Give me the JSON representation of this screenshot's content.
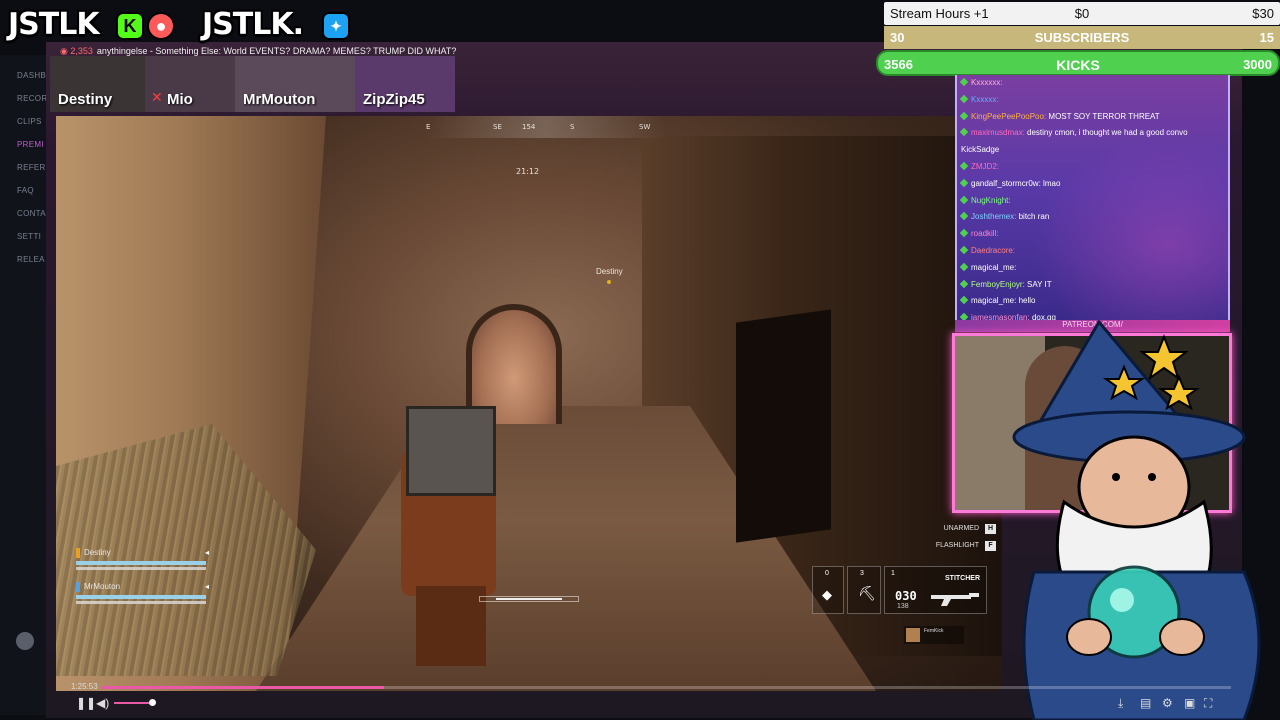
{
  "site_sidebar": {
    "items": [
      "DASHB",
      "RECOR",
      "CLIPS",
      "PREMI",
      "REFER",
      "FAQ",
      "CONTA",
      "SETTI",
      "RELEA"
    ]
  },
  "topbar": {
    "logo_1": "JSTLK",
    "logo_2": "JSTLK.",
    "ticker_count": "2,353",
    "ticker_text": "anythingelse - Something Else: World EVENTS? DRAMA? MEMES? TRUMP DID WHAT?"
  },
  "cams": [
    {
      "label": "Destiny"
    },
    {
      "label": "Mio"
    },
    {
      "label": "MrMouton"
    },
    {
      "label": "ZipZip45"
    }
  ],
  "goals": {
    "row1": {
      "left": "Stream Hours +1",
      "center": "$0",
      "right": "$30"
    },
    "row2": {
      "left": "30",
      "center": "SUBSCRIBERS",
      "right": "15"
    },
    "row3": {
      "left": "3566",
      "center": "KICKS",
      "right": "3000"
    }
  },
  "chat": {
    "messages": [
      {
        "user": "Kxxxxxx:",
        "color": "#ffb0d8",
        "text": ""
      },
      {
        "user": "Kxxxxx:",
        "color": "#5ab0ff",
        "text": ""
      },
      {
        "user": "KingPeePeePooPoo:",
        "color": "#ffb040",
        "text": "MOST SOY TERROR THREAT"
      },
      {
        "user": "maximusdmax:",
        "color": "#ff6ac0",
        "text": "destiny cmon, i thought we had a good convo"
      },
      {
        "user": "",
        "color": "#ffffff",
        "text": "KickSadge"
      },
      {
        "user": "ZMJD2:",
        "color": "#ff6ac0",
        "text": ""
      },
      {
        "user": "gandalf_stormcr0w:",
        "color": "#ffffff",
        "text": "lmao"
      },
      {
        "user": "NugKnight:",
        "color": "#7aff7a",
        "text": ""
      },
      {
        "user": "Joshthemex:",
        "color": "#80d0ff",
        "text": "bitch ran"
      },
      {
        "user": "roadkill:",
        "color": "#ff80d0",
        "text": ""
      },
      {
        "user": "Daedracore:",
        "color": "#ff8080",
        "text": ""
      },
      {
        "user": "magical_me:",
        "color": "#ffffff",
        "text": ""
      },
      {
        "user": "FemboyEnjoyr:",
        "color": "#b0ff80",
        "text": "SAY IT"
      },
      {
        "user": "magical_me:",
        "color": "#ffffff",
        "text": "hello"
      },
      {
        "user": "jamesmasonfan:",
        "color": "#ff8ad0",
        "text": "dox.gg"
      }
    ],
    "footer": "PATREON.COM/"
  },
  "game": {
    "compass": [
      "E",
      "SE",
      "154",
      "S",
      "SW"
    ],
    "timer": "21:12",
    "marker": "Destiny",
    "squad": [
      {
        "name": "Destiny",
        "tag_color": "#e8a020"
      },
      {
        "name": "MrMouton",
        "tag_color": "#5aa0e0"
      }
    ],
    "controls": [
      {
        "label": "UNARMED",
        "key": "H"
      },
      {
        "label": "FLASHLIGHT",
        "key": "F"
      }
    ],
    "slots": [
      "0",
      "3",
      "1"
    ],
    "weapon_name": "STITCHER",
    "ammo": "030",
    "reserve": "138",
    "notif": "FemKick"
  },
  "player": {
    "time": "1:25:53",
    "progress": 0.25,
    "volume": 0.7
  }
}
